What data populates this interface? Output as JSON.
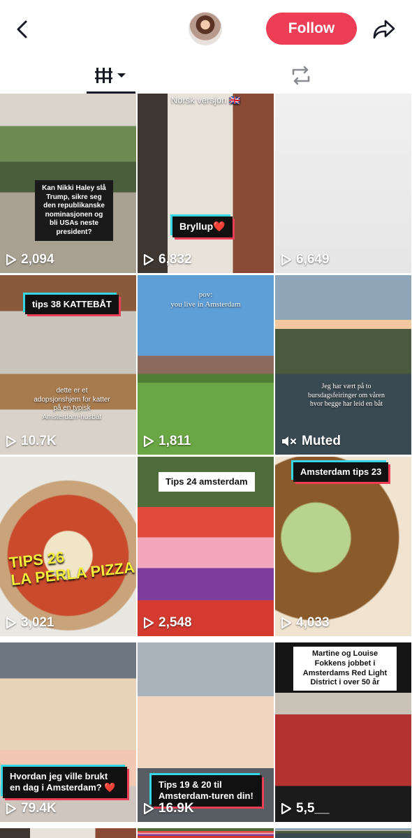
{
  "header": {
    "follow_label": "Follow",
    "icons": {
      "back": "back-chevron-icon",
      "share": "share-arrow-icon"
    }
  },
  "tabs": [
    {
      "name": "videos",
      "icon": "grid-dropdown-icon",
      "active": true
    },
    {
      "name": "reposts",
      "icon": "repost-icon",
      "active": false
    }
  ],
  "colors": {
    "accent": "#ee3e56",
    "cyan": "#35d6e6",
    "text": "#161823"
  },
  "grid": {
    "videos": [
      {
        "count": "2,094",
        "caption": "Kan Nikki Haley slå Trump, sikre seg den republikanske nominasjonen og bli USAs neste president?"
      },
      {
        "count": "6,832",
        "caption": "Bryllup❤️",
        "top_text": "Norsk versjon 🇬🇧"
      },
      {
        "count": "6,649",
        "caption": ""
      },
      {
        "count": "10.7K",
        "caption": "tips 38 KATTEBÅT",
        "sub_caption": "dette er et adopsjonshjem for katter på en typisk Amsterdam-husbåt"
      },
      {
        "count": "1,811",
        "caption": "pov:\nyou live in Amsterdam"
      },
      {
        "count": "Muted",
        "caption": "Jeg har vært på to bursdagsfeiringer om våren hvor begge har leid en båt",
        "muted": true
      },
      {
        "count": "3,021",
        "caption": "TIPS 26\nLA PERLA PIZZA"
      },
      {
        "count": "2,548",
        "caption": "Tips 24 amsterdam"
      },
      {
        "count": "4,033",
        "caption": "Amsterdam tips 23"
      },
      {
        "count": "79.4K",
        "caption": "Hvordan jeg ville brukt en dag i Amsterdam? ❤️"
      },
      {
        "count": "16.9K",
        "caption": "Tips 19 & 20 til Amsterdam-turen din!"
      },
      {
        "count": "5,5__",
        "caption": "Martine og Louise Fokkens jobbet i Amsterdams Red Light District i over 50 år"
      }
    ]
  }
}
